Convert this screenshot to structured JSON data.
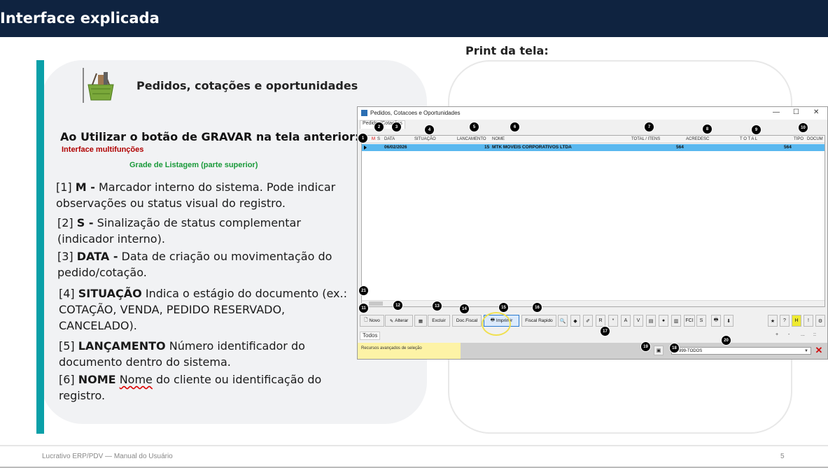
{
  "header": {
    "title": "Interface explicada"
  },
  "print_label": "Print da tela:",
  "module": {
    "title": "Pedidos, cotações e oportunidades",
    "icon": "shopping-basket-icon"
  },
  "heading": "Ao Utilizar o botão de GRAVAR na tela anterior:",
  "subtitle_red": "Interface multifunções",
  "subtitle_green": "Grade de Listagem (parte superior)",
  "items": [
    {
      "num": "[1]",
      "key": "M -",
      "text": "Marcador interno do sistema. Pode indicar observações ou status visual do registro."
    },
    {
      "num": "[2]",
      "key": "S -",
      "text": "Sinalização de status complementar (indicador interno)."
    },
    {
      "num": "[3]",
      "key": "DATA -",
      "text": "Data de criação ou movimentação do pedido/cotação."
    },
    {
      "num": "[4]",
      "key": "SITUAÇÃO",
      "text": "Indica o estágio do documento (ex.: COTAÇÃO, VENDA, PEDIDO RESERVADO, CANCELADO)."
    },
    {
      "num": "[5]",
      "key": "LANÇAMENTO",
      "text": "Número identificador do documento dentro do sistema."
    },
    {
      "num": "[6]",
      "key": "NOME",
      "text_underlined": "Nome",
      "text": "do cliente ou identificação do registro."
    }
  ],
  "footer": {
    "text": "Lucrativo ERP/PDV — Manual do Usuário",
    "page": "5"
  },
  "window": {
    "title": "Pedidos, Cotacoes e Oportunidades",
    "tab": "Pedidos/Cotações",
    "controls": {
      "minimize": "—",
      "maximize": "☐",
      "close": "✕"
    },
    "columns": [
      "M",
      "S",
      "DATA",
      "SITUAÇÃO",
      "LANCAMENTO",
      "NOME",
      "TOTAL / ITENS",
      "ACREDESC",
      "T O T A L",
      "TIPO",
      "DOCUM"
    ],
    "row": {
      "data": "06/02/2026",
      "situacao": "",
      "lancamento": "15",
      "nome": "MTK MOVEIS CORPORATIVOS LTDA",
      "total_itens": "564",
      "acredesc": "",
      "total": "564"
    },
    "toolbar": {
      "novo": "Novo",
      "alterar": "Alterar",
      "excluir": "Excluir",
      "doc_fiscal": "Doc.Fiscal",
      "imprimir": "Imprimir",
      "fiscal_rapido": "Fiscal Rapido",
      "small": [
        "R",
        "*",
        "A",
        "V",
        "FCI",
        "S"
      ]
    },
    "todos_tab": "Todos",
    "status_text": "Recursos avançados de seleção",
    "combo_value": "999-TODOS",
    "mini_buttons": [
      "+",
      "-",
      "...",
      "::"
    ]
  },
  "markers": [
    "1",
    "2",
    "3",
    "4",
    "5",
    "6",
    "7",
    "8",
    "9",
    "10",
    "11",
    "12",
    "13",
    "14",
    "15",
    "16",
    "17",
    "18",
    "19",
    "20",
    "21"
  ],
  "colors": {
    "topbar": "#0f2340",
    "accent": "#0aa0a8",
    "selected_row": "#5ab8ef",
    "red": "#b00000",
    "green": "#1a9a3a"
  }
}
